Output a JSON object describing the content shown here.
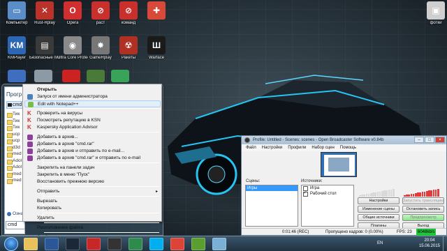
{
  "desktop": {
    "icons": [
      {
        "label": "Компьютер",
        "color": "#5b8ec9",
        "glyph": "▭"
      },
      {
        "label": "Rust-Rplay",
        "color": "#b9332a",
        "glyph": "✕"
      },
      {
        "label": "Opera",
        "color": "#d12f2f",
        "glyph": "O"
      },
      {
        "label": "pacт",
        "color": "#c9302c",
        "glyph": "⊘"
      },
      {
        "label": "команд",
        "color": "#c9302c",
        "glyph": "⊘"
      },
      {
        "label": "",
        "color": "#d8493a",
        "glyph": "✚"
      },
      {
        "label": "фотки",
        "color": "#cfcfcf",
        "glyph": "▣"
      },
      {
        "label": "KMPlayer",
        "color": "#2c67b3",
        "glyph": "KM"
      },
      {
        "label": "Безопасные платежи",
        "color": "#3a3a3a",
        "glyph": "▤"
      },
      {
        "label": "Ultra Core Protector",
        "color": "#8a8a8a",
        "glyph": "◉"
      },
      {
        "label": "GameRplay",
        "color": "#777777",
        "glyph": "✸"
      },
      {
        "label": "Ракеты",
        "color": "#b03024",
        "glyph": "☢"
      },
      {
        "label": "Warface",
        "color": "#1a1a1a",
        "glyph": "Ш"
      }
    ]
  },
  "start_menu": {
    "programs_header": "Прогр",
    "cmd_item": "cmd",
    "files": [
      "Тик",
      "Тик",
      "Тик",
      "ucp",
      "ucp",
      "d3d",
      "med",
      "Adol",
      "Adol",
      "med",
      "med"
    ],
    "more_results": "Ознак",
    "search_value": "cmd"
  },
  "context_menu": {
    "items": [
      {
        "label": "Открыть",
        "bold": true,
        "icon": "none"
      },
      {
        "label": "Запуск от имени администратора",
        "icon": "shield-icon",
        "color": "#4a7fc1"
      },
      {
        "label": "Edit with Notepad++",
        "icon": "notepad-icon",
        "color": "#7bbd4a",
        "highlight": true
      },
      {
        "label": "Проверить на вирусы",
        "icon": "kaspersky-icon",
        "color": "#d12f2f"
      },
      {
        "label": "Посмотреть репутацию в KSN",
        "icon": "kaspersky-icon",
        "color": "#d12f2f"
      },
      {
        "label": "Kaspersky Application Advisor",
        "icon": "kaspersky-icon",
        "color": "#d12f2f"
      },
      {
        "label": "Добавить в архив...",
        "icon": "archive-icon",
        "color": "#8e3e9b"
      },
      {
        "label": "Добавить в архив \"cmd.rar\"",
        "icon": "archive-icon",
        "color": "#8e3e9b"
      },
      {
        "label": "Добавить в архив и отправить по e-mail...",
        "icon": "archive-icon",
        "color": "#8e3e9b"
      },
      {
        "label": "Добавить в архив \"cmd.rar\" и отправить по e-mail",
        "icon": "archive-icon",
        "color": "#8e3e9b"
      },
      {
        "label": "Закрепить на панели задач",
        "icon": "none"
      },
      {
        "label": "Закрепить в меню \"Пуск\"",
        "icon": "none"
      },
      {
        "label": "Восстановить прежнюю версию",
        "icon": "none"
      },
      {
        "label": "Отправить",
        "icon": "none",
        "submenu": true
      },
      {
        "label": "Вырезать",
        "icon": "none"
      },
      {
        "label": "Копировать",
        "icon": "none"
      },
      {
        "label": "Удалить",
        "icon": "none"
      },
      {
        "label": "Расположение файла",
        "icon": "none"
      },
      {
        "label": "Свойства",
        "icon": "none"
      }
    ]
  },
  "obs": {
    "title": "Profile: Untitled - Scenes: scenes - Open Broadcaster Software v0.84b",
    "menu": [
      "Файл",
      "Настройки",
      "Профили",
      "Набор сцен",
      "Помощь"
    ],
    "scenes_label": "Сцены:",
    "sources_label": "Источники:",
    "scenes": [
      "Игры"
    ],
    "sources": [
      {
        "label": "Игра",
        "checked": false
      },
      {
        "label": "Рабочий стол",
        "checked": true
      }
    ],
    "buttons": {
      "settings": "Настройки",
      "start_stream": "Запустить трансляцию",
      "edit_scene": "Изменение сцены",
      "stop_recording": "Остановить запись",
      "global_sources": "Общие источники",
      "preview": "Предпросмотр",
      "plugins": "Плагины",
      "exit": "Выход"
    },
    "status": {
      "time": "0:01:46 (REC)",
      "dropped": "Пропущено кадров: 0 (0.00%)",
      "fps": "FPS: 23",
      "kbps": "6048kb/s"
    }
  },
  "taskbar": {
    "apps": [
      {
        "name": "explorer-icon",
        "color": "#e8c15a"
      },
      {
        "name": "word-icon",
        "color": "#2b5797"
      },
      {
        "name": "steam-icon",
        "color": "#1b2838"
      },
      {
        "name": "record-icon",
        "color": "#c62828"
      },
      {
        "name": "obs-icon",
        "color": "#333333"
      },
      {
        "name": "kaspersky-icon",
        "color": "#2f8a4e"
      },
      {
        "name": "skype-icon",
        "color": "#00aff0"
      },
      {
        "name": "chrome-icon",
        "color": "#db4437"
      },
      {
        "name": "utorrent-icon",
        "color": "#5a9e2f"
      },
      {
        "name": "screenshot-icon",
        "color": "#7ab0d6"
      }
    ],
    "language": "EN",
    "time": "20:04",
    "date": "15.06.2015"
  }
}
